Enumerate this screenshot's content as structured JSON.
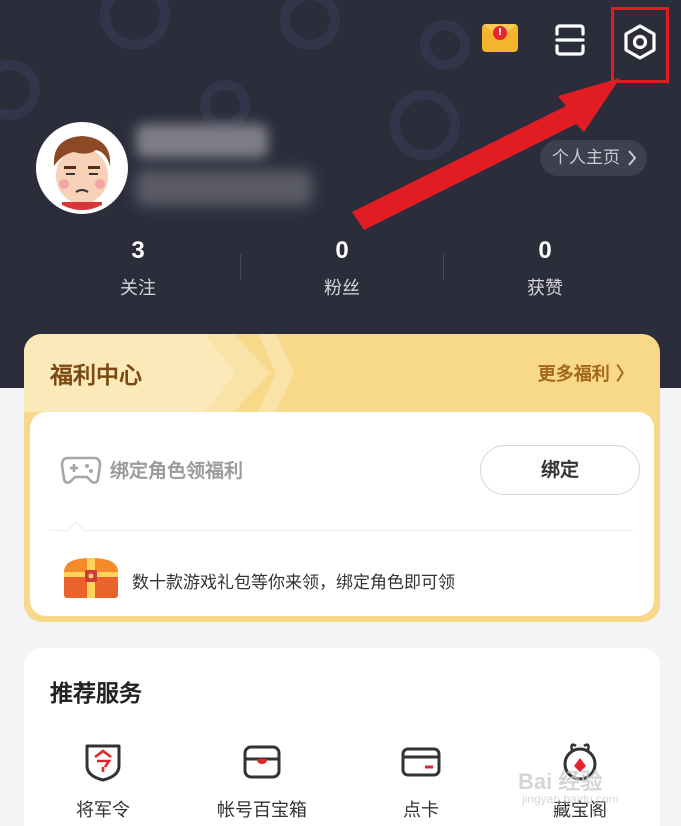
{
  "header": {
    "profile_link": "个人主页",
    "stats": [
      {
        "value": "3",
        "label": "关注"
      },
      {
        "value": "0",
        "label": "粉丝"
      },
      {
        "value": "0",
        "label": "获赞"
      }
    ]
  },
  "welfare": {
    "title": "福利中心",
    "more": "更多福利 〉",
    "bind_text": "绑定角色领福利",
    "bind_button": "绑定",
    "gift_text": "数十款游戏礼包等你来领，绑定角色即可领"
  },
  "services": {
    "title": "推荐服务",
    "items": [
      {
        "label": "将军令",
        "icon": "shield-icon"
      },
      {
        "label": "帐号百宝箱",
        "icon": "box-icon"
      },
      {
        "label": "点卡",
        "icon": "card-icon"
      },
      {
        "label": "藏宝阁",
        "icon": "treasure-pavilion-icon"
      }
    ]
  },
  "watermark": {
    "main": "Bai 经验",
    "sub": "jingyan.baidu.com"
  },
  "colors": {
    "header_bg": "#2c2d3b",
    "welfare_bg": "#f8d98a",
    "accent_red": "#e21c23"
  }
}
